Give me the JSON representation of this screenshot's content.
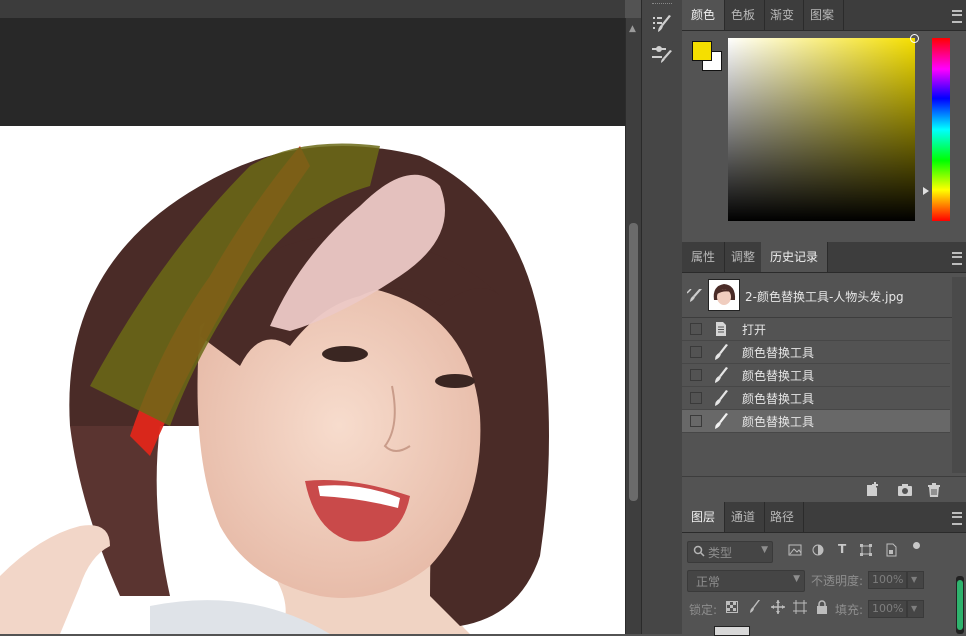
{
  "color_panel": {
    "tabs": [
      "颜色",
      "色板",
      "渐变",
      "图案"
    ],
    "active_tab": "颜色",
    "foreground_color": "#f5df00",
    "background_color": "#ffffff"
  },
  "history_panel": {
    "tabs": [
      "属性",
      "调整",
      "历史记录"
    ],
    "active_tab": "历史记录",
    "snapshot_label": "2-颜色替换工具-人物头发.jpg",
    "entries": [
      {
        "label": "打开",
        "icon": "document-icon"
      },
      {
        "label": "颜色替换工具",
        "icon": "brush-icon"
      },
      {
        "label": "颜色替换工具",
        "icon": "brush-icon"
      },
      {
        "label": "颜色替换工具",
        "icon": "brush-icon"
      },
      {
        "label": "颜色替换工具",
        "icon": "brush-icon",
        "selected": true
      }
    ],
    "footer_icons": [
      "new-document-from-state-icon",
      "camera-icon",
      "trash-icon"
    ]
  },
  "layers_panel": {
    "tabs": [
      "图层",
      "通道",
      "路径"
    ],
    "active_tab": "图层",
    "filter_label": "类型",
    "blend_mode": "正常",
    "opacity_label": "不透明度:",
    "opacity_value": "100%",
    "lock_label": "锁定:",
    "fill_label": "填充:",
    "fill_value": "100%"
  },
  "toolstrip": {
    "icons": [
      "brush-settings-icon",
      "brush-presets-icon"
    ]
  }
}
